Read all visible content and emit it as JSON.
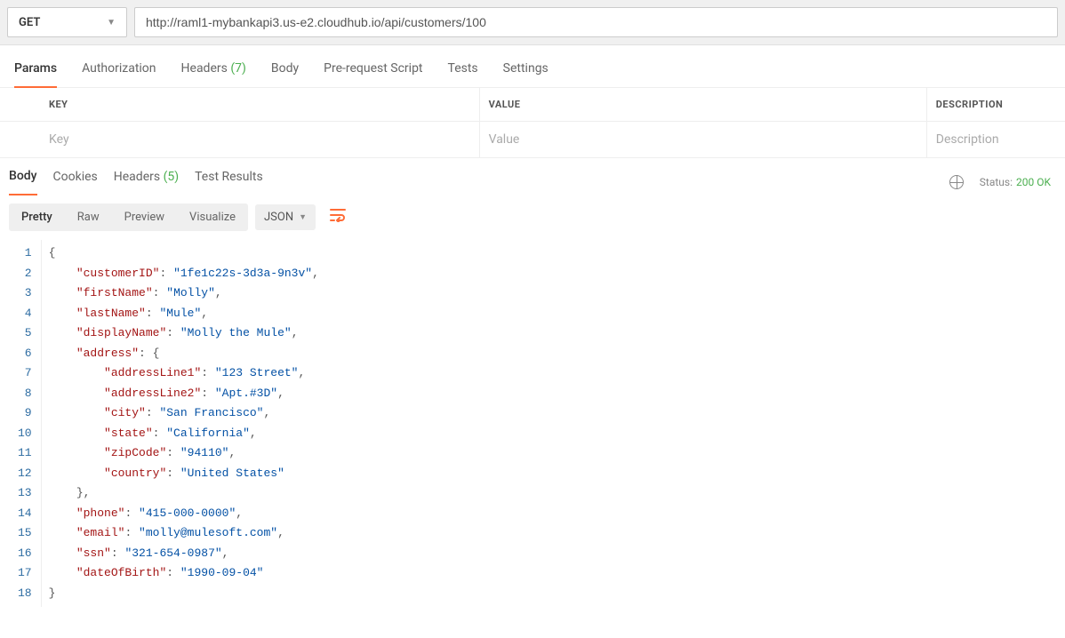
{
  "request": {
    "method": "GET",
    "url": "http://raml1-mybankapi3.us-e2.cloudhub.io/api/customers/100"
  },
  "reqTabs": {
    "params": "Params",
    "authorization": "Authorization",
    "headers": "Headers",
    "headersCount": "(7)",
    "body": "Body",
    "preRequest": "Pre-request Script",
    "tests": "Tests",
    "settings": "Settings"
  },
  "kvHeaders": {
    "key": "KEY",
    "value": "VALUE",
    "description": "DESCRIPTION"
  },
  "kvPlaceholders": {
    "key": "Key",
    "value": "Value",
    "description": "Description"
  },
  "respTabs": {
    "body": "Body",
    "cookies": "Cookies",
    "headers": "Headers",
    "headersCount": "(5)",
    "testResults": "Test Results"
  },
  "status": {
    "label": "Status:",
    "code": "200 OK"
  },
  "viewModes": {
    "pretty": "Pretty",
    "raw": "Raw",
    "preview": "Preview",
    "visualize": "Visualize"
  },
  "format": "JSON",
  "responseBody": {
    "customerID": "1fe1c22s-3d3a-9n3v",
    "firstName": "Molly",
    "lastName": "Mule",
    "displayName": "Molly the Mule",
    "address": {
      "addressLine1": "123 Street",
      "addressLine2": "Apt.#3D",
      "city": "San Francisco",
      "state": "California",
      "zipCode": "94110",
      "country": "United States"
    },
    "phone": "415-000-0000",
    "email": "molly@mulesoft.com",
    "ssn": "321-654-0987",
    "dateOfBirth": "1990-09-04"
  },
  "lines": [
    "1",
    "2",
    "3",
    "4",
    "5",
    "6",
    "7",
    "8",
    "9",
    "10",
    "11",
    "12",
    "13",
    "14",
    "15",
    "16",
    "17",
    "18"
  ]
}
